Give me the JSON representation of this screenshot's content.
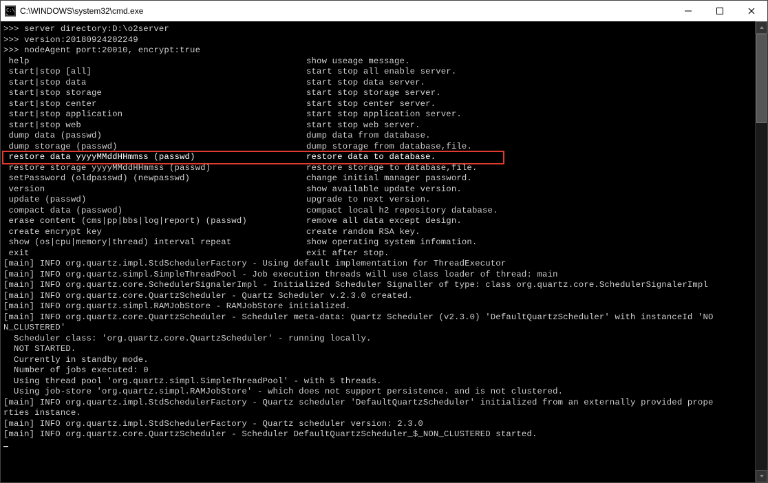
{
  "title": "C:\\WINDOWS\\system32\\cmd.exe",
  "prompts": [
    ">>> server directory:D:\\o2server",
    ">>> version:20180924202249",
    ">>> nodeAgent port:20010, encrypt:true"
  ],
  "helpRows": [
    {
      "cmd": " help",
      "desc": "show useage message."
    },
    {
      "cmd": " start|stop [all]",
      "desc": "start stop all enable server."
    },
    {
      "cmd": " start|stop data",
      "desc": "start stop data server."
    },
    {
      "cmd": " start|stop storage",
      "desc": "start stop storage server."
    },
    {
      "cmd": " start|stop center",
      "desc": "start stop center server."
    },
    {
      "cmd": " start|stop application",
      "desc": "start stop application server."
    },
    {
      "cmd": " start|stop web",
      "desc": "start stop web server."
    },
    {
      "cmd": " dump data (passwd)",
      "desc": "dump data from database."
    },
    {
      "cmd": " dump storage (passwd)",
      "desc": "dump storage from database,file."
    },
    {
      "cmd": " restore data yyyyMMddHHmmss (passwd)",
      "desc": "restore data to database.",
      "hl": true
    },
    {
      "cmd": " restore storage yyyyMMddHHmmss (passwd)",
      "desc": "restore storage to database,file."
    },
    {
      "cmd": " setPassword (oldpasswd) (newpasswd)",
      "desc": "change initial manager password."
    },
    {
      "cmd": " version",
      "desc": "show available update version."
    },
    {
      "cmd": " update (passwd)",
      "desc": "upgrade to next version."
    },
    {
      "cmd": " compact data (passwod)",
      "desc": "compact local h2 repository database."
    },
    {
      "cmd": " erase content (cms|pp|bbs|log|report) (passwd)",
      "desc": "remove all data except design."
    },
    {
      "cmd": " create encrypt key",
      "desc": "create random RSA key."
    },
    {
      "cmd": " show (os|cpu|memory|thread) interval repeat",
      "desc": "show operating system infomation."
    },
    {
      "cmd": " exit",
      "desc": "exit after stop."
    }
  ],
  "logLines": [
    "",
    "[main] INFO org.quartz.impl.StdSchedulerFactory - Using default implementation for ThreadExecutor",
    "[main] INFO org.quartz.simpl.SimpleThreadPool - Job execution threads will use class loader of thread: main",
    "[main] INFO org.quartz.core.SchedulerSignalerImpl - Initialized Scheduler Signaller of type: class org.quartz.core.SchedulerSignalerImpl",
    "[main] INFO org.quartz.core.QuartzScheduler - Quartz Scheduler v.2.3.0 created.",
    "[main] INFO org.quartz.simpl.RAMJobStore - RAMJobStore initialized.",
    "[main] INFO org.quartz.core.QuartzScheduler - Scheduler meta-data: Quartz Scheduler (v2.3.0) 'DefaultQuartzScheduler' with instanceId 'NO",
    "N_CLUSTERED'",
    "  Scheduler class: 'org.quartz.core.QuartzScheduler' - running locally.",
    "  NOT STARTED.",
    "  Currently in standby mode.",
    "  Number of jobs executed: 0",
    "  Using thread pool 'org.quartz.simpl.SimpleThreadPool' - with 5 threads.",
    "  Using job-store 'org.quartz.simpl.RAMJobStore' - which does not support persistence. and is not clustered.",
    "",
    "[main] INFO org.quartz.impl.StdSchedulerFactory - Quartz scheduler 'DefaultQuartzScheduler' initialized from an externally provided prope",
    "rties instance.",
    "[main] INFO org.quartz.impl.StdSchedulerFactory - Quartz scheduler version: 2.3.0",
    "[main] INFO org.quartz.core.QuartzScheduler - Scheduler DefaultQuartzScheduler_$_NON_CLUSTERED started."
  ]
}
